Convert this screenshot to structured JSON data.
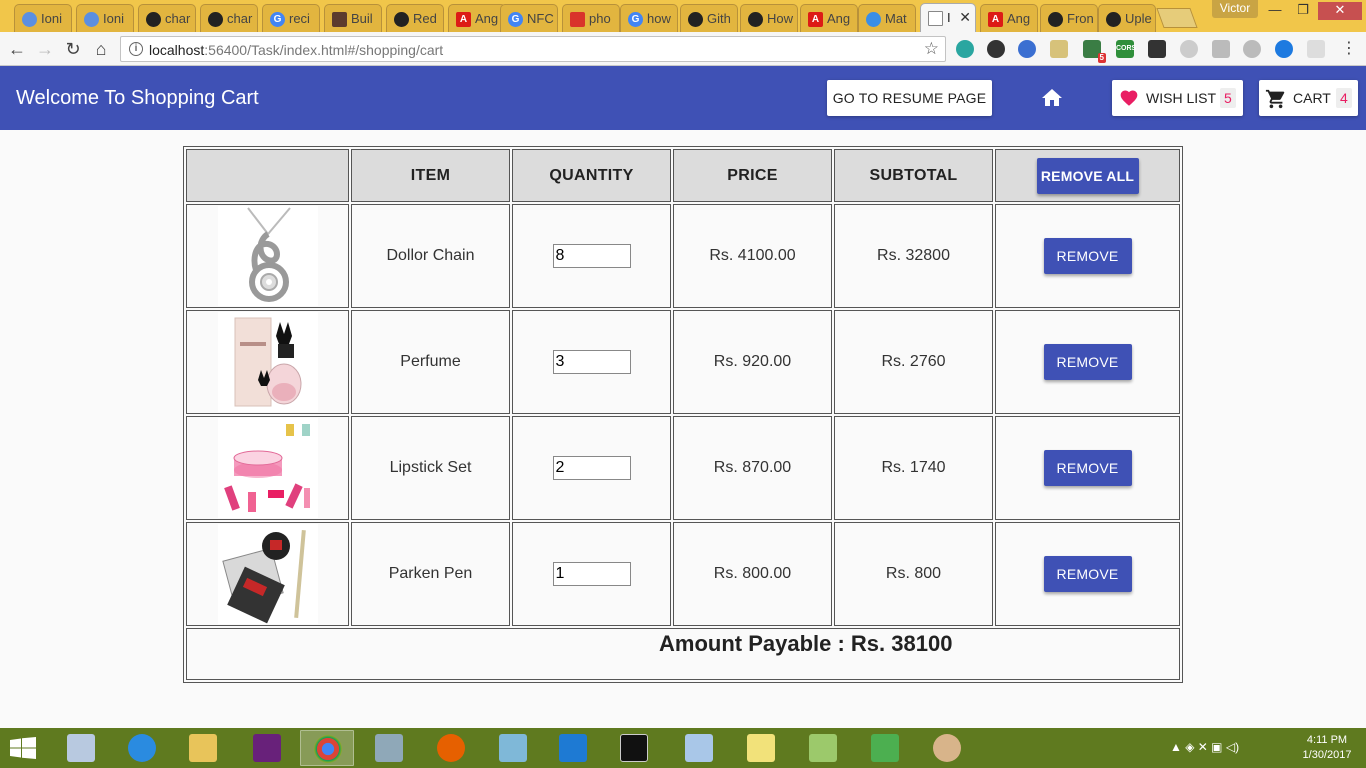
{
  "browser": {
    "tabs": [
      {
        "label": "Ioni",
        "icon": "ionic-icon"
      },
      {
        "label": "Ioni",
        "icon": "ionic-icon"
      },
      {
        "label": "char",
        "icon": "github-icon"
      },
      {
        "label": "char",
        "icon": "github-icon"
      },
      {
        "label": "reci",
        "icon": "google-icon"
      },
      {
        "label": "Buil",
        "icon": "office-icon"
      },
      {
        "label": "Red",
        "icon": "github-icon"
      },
      {
        "label": "Ang",
        "icon": "angular-icon"
      },
      {
        "label": "NFC",
        "icon": "google-icon"
      },
      {
        "label": "pho",
        "icon": "page-icon"
      },
      {
        "label": "how",
        "icon": "google-icon"
      },
      {
        "label": "Gith",
        "icon": "github-icon"
      },
      {
        "label": "How",
        "icon": "github-icon"
      },
      {
        "label": "Ang",
        "icon": "angular-icon"
      },
      {
        "label": "Mat",
        "icon": "material-icon"
      },
      {
        "label": "I",
        "icon": "document-icon",
        "active": true
      },
      {
        "label": "Ang",
        "icon": "angular-icon"
      },
      {
        "label": "Fron",
        "icon": "github-icon"
      },
      {
        "label": "Uple",
        "icon": "github-icon"
      }
    ],
    "profile_name": "Victor",
    "url_host": "localhost",
    "url_rest": ":56400/Task/index.html#/shopping/cart",
    "extension_badge": "5",
    "extension_cors_label": "CORS"
  },
  "header": {
    "title": "Welcome To Shopping Cart",
    "resume_button": "GO TO RESUME PAGE",
    "wishlist_label": "WISH LIST",
    "wishlist_count": "5",
    "cart_label": "CART",
    "cart_count": "4",
    "accent_color": "#3f51b5",
    "badge_color": "#e91e63"
  },
  "table": {
    "columns": [
      "",
      "ITEM",
      "QUANTITY",
      "PRICE",
      "SUBTOTAL"
    ],
    "remove_all_label": "REMOVE ALL",
    "remove_label": "REMOVE",
    "rows": [
      {
        "item": "Dollor Chain",
        "quantity": "8",
        "price": "Rs. 4100.00",
        "subtotal": "Rs. 32800",
        "image": "chain-pendant-icon"
      },
      {
        "item": "Perfume",
        "quantity": "3",
        "price": "Rs. 920.00",
        "subtotal": "Rs. 2760",
        "image": "perfume-bottle-icon"
      },
      {
        "item": "Lipstick Set",
        "quantity": "2",
        "price": "Rs. 870.00",
        "subtotal": "Rs. 1740",
        "image": "lipstick-set-icon"
      },
      {
        "item": "Parken Pen",
        "quantity": "1",
        "price": "Rs. 800.00",
        "subtotal": "Rs. 800",
        "image": "pen-gift-box-icon"
      }
    ],
    "total_text": "Amount Payable : Rs. 38100"
  },
  "taskbar": {
    "time": "4:11 PM",
    "date": "1/30/2017"
  }
}
